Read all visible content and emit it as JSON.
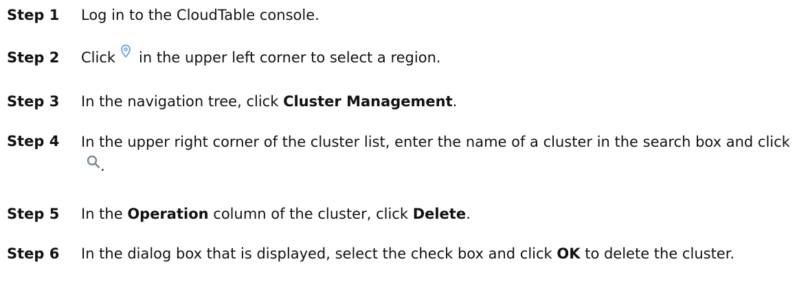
{
  "steps": [
    {
      "label": "Step 1",
      "text": "Log in to the CloudTable console."
    },
    {
      "label": "Step 2",
      "before": "Click",
      "icon": "location-pin-icon",
      "after": "in the upper left corner to select a region."
    },
    {
      "label": "Step 3",
      "before": "In the navigation tree, click ",
      "bold": "Cluster Management",
      "after": "."
    },
    {
      "label": "Step 4",
      "before": "In the upper right corner of the cluster list, enter the name of a cluster in the search box and click",
      "icon": "search-icon",
      "after": "."
    },
    {
      "label": "Step 5",
      "t1": "In the ",
      "b1": "Operation",
      "t2": " column of the cluster, click ",
      "b2": "Delete",
      "t3": "."
    },
    {
      "label": "Step 6",
      "before": "In the dialog box that is displayed, select the check box and click ",
      "bold": "OK",
      "after": " to delete the cluster."
    }
  ],
  "colors": {
    "pin_icon": "#6fa8e0",
    "search_icon": "#7a8794"
  }
}
